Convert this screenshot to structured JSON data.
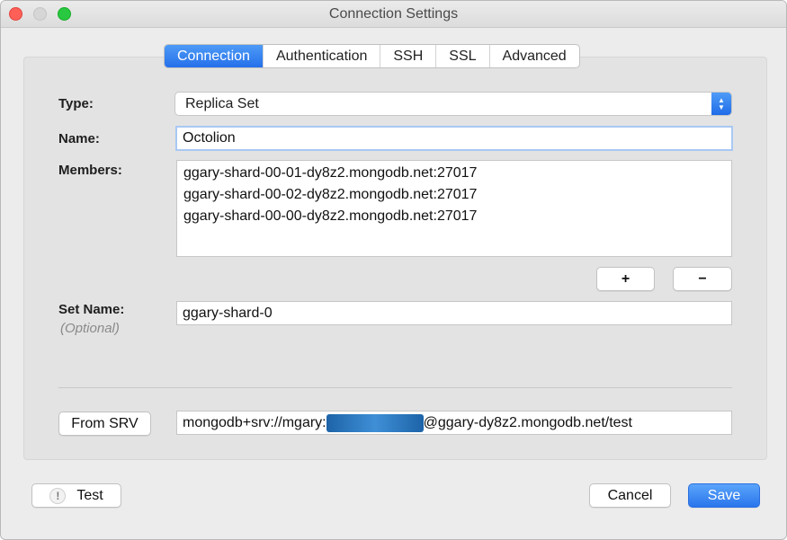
{
  "window": {
    "title": "Connection Settings"
  },
  "tabs": [
    {
      "label": "Connection",
      "active": true
    },
    {
      "label": "Authentication",
      "active": false
    },
    {
      "label": "SSH",
      "active": false
    },
    {
      "label": "SSL",
      "active": false
    },
    {
      "label": "Advanced",
      "active": false
    }
  ],
  "form": {
    "type_label": "Type:",
    "type_value": "Replica Set",
    "name_label": "Name:",
    "name_value": "Octolion",
    "members_label": "Members:",
    "members": [
      "ggary-shard-00-01-dy8z2.mongodb.net:27017",
      "ggary-shard-00-02-dy8z2.mongodb.net:27017",
      "ggary-shard-00-00-dy8z2.mongodb.net:27017"
    ],
    "add_label": "+",
    "remove_label": "−",
    "set_name_label": "Set Name:",
    "set_name_hint": "(Optional)",
    "set_name_value": "ggary-shard-0",
    "from_srv_label": "From SRV",
    "srv_prefix": "mongodb+srv://mgary:",
    "srv_suffix": "@ggary-dy8z2.mongodb.net/test"
  },
  "footer": {
    "test_label": "Test",
    "test_icon": "!",
    "cancel_label": "Cancel",
    "save_label": "Save"
  },
  "colors": {
    "accent": "#2a75ec",
    "close": "#fe5f57",
    "zoom": "#28c840"
  }
}
